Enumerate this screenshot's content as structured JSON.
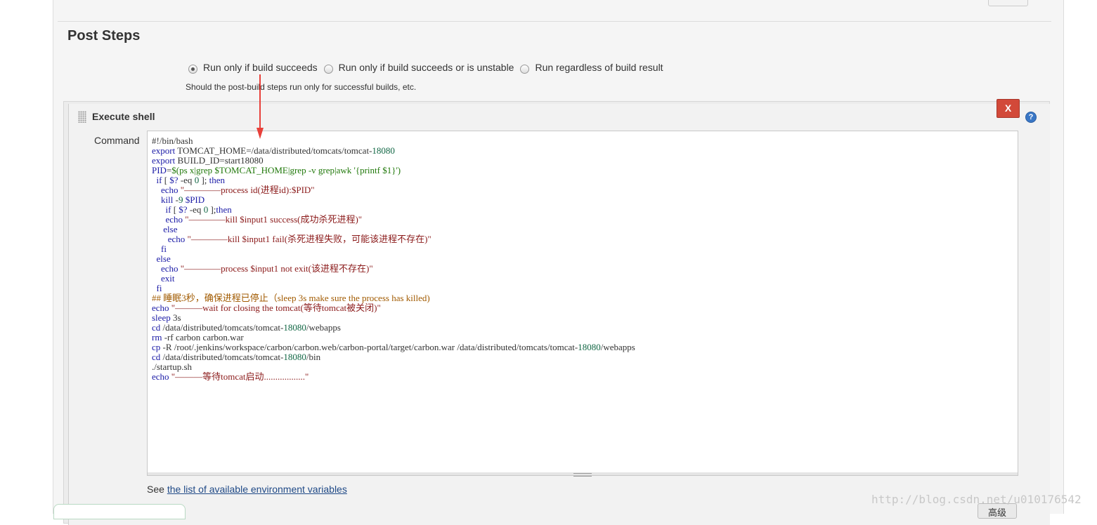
{
  "section": {
    "title": "Post Steps"
  },
  "run_condition": {
    "options": [
      {
        "label": "Run only if build succeeds",
        "selected": true
      },
      {
        "label": "Run only if build succeeds or is unstable",
        "selected": false
      },
      {
        "label": "Run regardless of build result",
        "selected": false
      }
    ],
    "help_text": "Should the post-build steps run only for successful builds, etc."
  },
  "build_step": {
    "title": "Execute shell",
    "delete_label": "X",
    "help_label": "?",
    "command_label": "Command",
    "command_lines": [
      "#!/bin/bash",
      "export TOMCAT_HOME=/data/distributed/tomcats/tomcat-18080",
      "export BUILD_ID=start18080",
      "PID=$(ps x|grep $TOMCAT_HOME|grep -v grep|awk '{printf $1}')",
      "  if [ $? -eq 0 ]; then",
      "    echo \"————process id(进程id):$PID\"",
      "    kill -9 $PID",
      "      if [ $? -eq 0 ];then",
      "      echo \"————kill $input1 success(成功杀死进程)\"",
      "     else",
      "       echo \"————kill $input1 fail(杀死进程失败，可能该进程不存在)\"",
      "    fi",
      "  else",
      "    echo \"————process $input1 not exit(该进程不存在)\"",
      "    exit",
      "  fi",
      "## 睡眠3秒，确保进程已停止（sleep 3s make sure the process has killed)",
      "echo \"———wait for closing the tomcat(等待tomcat被关闭)\"",
      "sleep 3s",
      "cd /data/distributed/tomcats/tomcat-18080/webapps",
      "rm -rf carbon carbon.war",
      "cp -R /root/.jenkins/workspace/carbon/carbon.web/carbon-portal/target/carbon.war /data/distributed/tomcats/tomcat-18080/webapps",
      "cd /data/distributed/tomcats/tomcat-18080/bin",
      "./startup.sh",
      "echo \"———等待tomcat启动..................\""
    ],
    "env_prefix": "See ",
    "env_link": "the list of available environment variables"
  },
  "footer": {
    "advanced_label": "高级"
  },
  "watermark": "http://blog.csdn.net/u010176542",
  "colors": {
    "delete_button": "#d24939",
    "link": "#204a87",
    "arrow": "#e8403a"
  }
}
